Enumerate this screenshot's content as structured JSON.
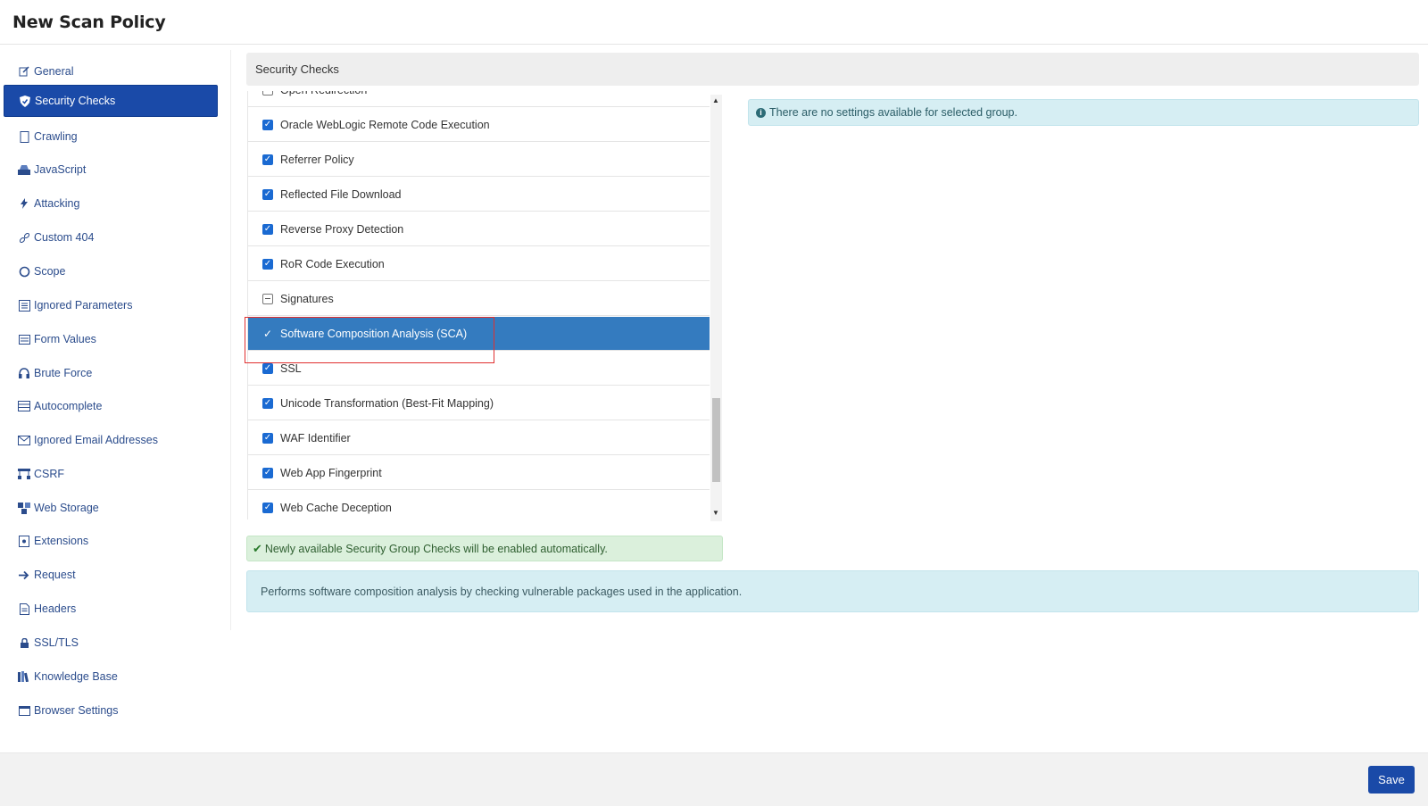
{
  "header": {
    "title": "New Scan Policy"
  },
  "sidebar": {
    "items": [
      {
        "label": "General",
        "icon": "edit-icon"
      },
      {
        "label": "Security Checks",
        "icon": "shield-icon",
        "active": true
      },
      {
        "label": "Crawling",
        "icon": "page-icon"
      },
      {
        "label": "JavaScript",
        "icon": "drive-icon"
      },
      {
        "label": "Attacking",
        "icon": "bolt-icon"
      },
      {
        "label": "Custom 404",
        "icon": "link-icon"
      },
      {
        "label": "Scope",
        "icon": "circle-icon"
      },
      {
        "label": "Ignored Parameters",
        "icon": "list-icon"
      },
      {
        "label": "Form Values",
        "icon": "form-icon"
      },
      {
        "label": "Brute Force",
        "icon": "headphones-icon"
      },
      {
        "label": "Autocomplete",
        "icon": "table-icon"
      },
      {
        "label": "Ignored Email Addresses",
        "icon": "envelope-icon"
      },
      {
        "label": "CSRF",
        "icon": "sitemap-icon"
      },
      {
        "label": "Web Storage",
        "icon": "cubes-icon"
      },
      {
        "label": "Extensions",
        "icon": "puzzle-icon"
      },
      {
        "label": "Request",
        "icon": "arrow-right-icon"
      },
      {
        "label": "Headers",
        "icon": "file-icon"
      },
      {
        "label": "SSL/TLS",
        "icon": "lock-icon"
      },
      {
        "label": "Knowledge Base",
        "icon": "books-icon"
      },
      {
        "label": "Browser Settings",
        "icon": "window-icon"
      }
    ]
  },
  "panel": {
    "title": "Security Checks"
  },
  "checks": [
    {
      "label": "Open Redirection",
      "state": "partial"
    },
    {
      "label": "Oracle WebLogic Remote Code Execution",
      "state": "checked"
    },
    {
      "label": "Referrer Policy",
      "state": "checked"
    },
    {
      "label": "Reflected File Download",
      "state": "checked"
    },
    {
      "label": "Reverse Proxy Detection",
      "state": "checked"
    },
    {
      "label": "RoR Code Execution",
      "state": "checked"
    },
    {
      "label": "Signatures",
      "state": "partial"
    },
    {
      "label": "Software Composition Analysis (SCA)",
      "state": "checked",
      "selected": true
    },
    {
      "label": "SSL",
      "state": "checked"
    },
    {
      "label": "Unicode Transformation (Best-Fit Mapping)",
      "state": "checked"
    },
    {
      "label": "WAF Identifier",
      "state": "checked"
    },
    {
      "label": "Web App Fingerprint",
      "state": "checked"
    },
    {
      "label": "Web Cache Deception",
      "state": "checked"
    }
  ],
  "settings_info": "There are no settings available for selected group.",
  "auto_enable_note": "Newly available Security Group Checks will be enabled automatically.",
  "description": "Performs software composition analysis by checking vulnerable packages used in the application.",
  "footer": {
    "save_label": "Save"
  },
  "colors": {
    "accent": "#1a4aa8",
    "selected_row": "#347bbf",
    "highlight_box": "#e03030"
  }
}
